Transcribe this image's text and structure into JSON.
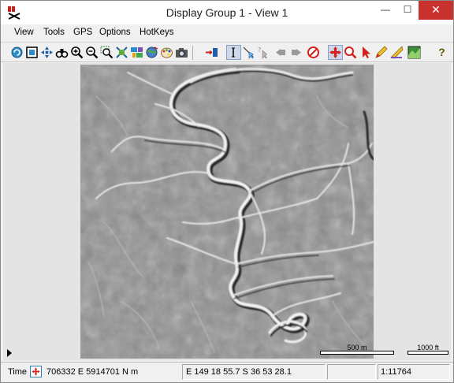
{
  "window": {
    "title": "Display Group 1 - View 1",
    "minimize_glyph": "—",
    "maximize_glyph": "☐",
    "close_glyph": "✕"
  },
  "menu": {
    "items": [
      "View",
      "Tools",
      "GPS",
      "Options",
      "HotKeys"
    ]
  },
  "toolbar": {
    "icons": [
      "redraw-icon",
      "full-view-icon",
      "zoom-to-layer-icon",
      "binoculars-icon",
      "zoom-in-icon",
      "zoom-out-icon",
      "zoom-box-icon",
      "zoom-grid-icon",
      "layer-manager-icon",
      "globe-icon",
      "palette-icon",
      "camera-icon",
      "add-layer-icon",
      "select-text-icon",
      "select-pointer-icon",
      "help-pointer-icon",
      "back-icon",
      "forward-icon",
      "stop-icon",
      "pan-icon",
      "zoom-tool-icon",
      "select-tool-icon",
      "sketch-tool-icon",
      "measure-icon",
      "render-icon",
      "help-icon"
    ],
    "help_glyph": "?"
  },
  "map": {
    "scale_bar_metric": "500 m",
    "scale_bar_imperial": "1000 ft"
  },
  "status": {
    "time_label": "Time",
    "projected_coords": "706332 E  5914701 N m",
    "geographic_coords": "E 149 18 55.7  S 36 53 28.1",
    "scale": "1:11764"
  }
}
